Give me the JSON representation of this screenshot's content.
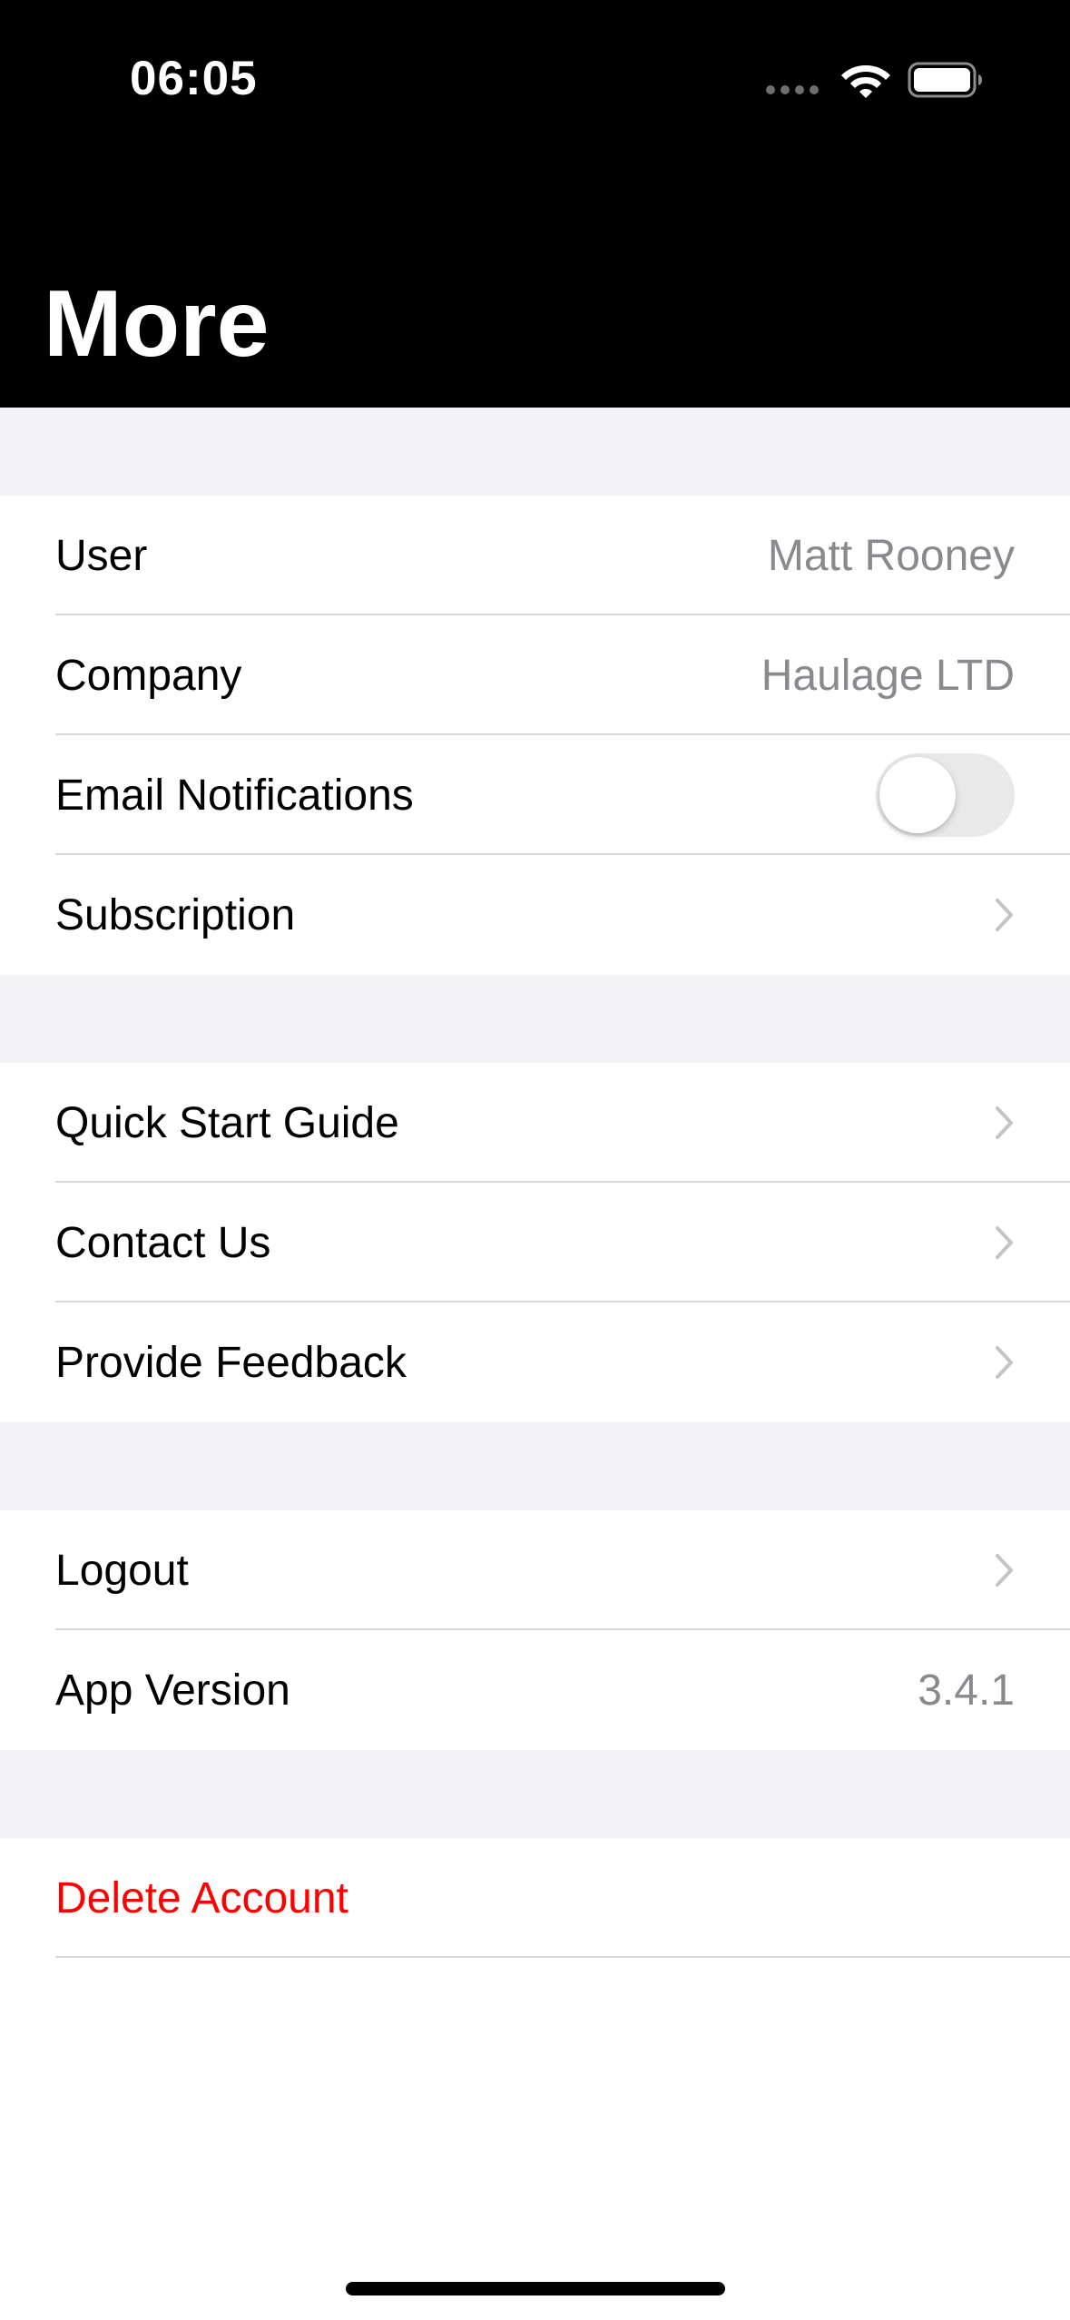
{
  "status_bar": {
    "time": "06:05"
  },
  "header": {
    "title": "More"
  },
  "sections": {
    "account": {
      "user_label": "User",
      "user_value": "Matt Rooney",
      "company_label": "Company",
      "company_value": "Haulage LTD",
      "email_notifications_label": "Email Notifications",
      "email_notifications_enabled": false,
      "subscription_label": "Subscription"
    },
    "help": {
      "quick_start_label": "Quick Start Guide",
      "contact_label": "Contact Us",
      "feedback_label": "Provide Feedback"
    },
    "app": {
      "logout_label": "Logout",
      "version_label": "App Version",
      "version_value": "3.4.1"
    },
    "danger": {
      "delete_label": "Delete Account"
    }
  },
  "colors": {
    "header_bg": "#000000",
    "group_bg": "#f2f2f7",
    "destructive": "#ff0000",
    "secondary_text": "#8a8a8e"
  }
}
